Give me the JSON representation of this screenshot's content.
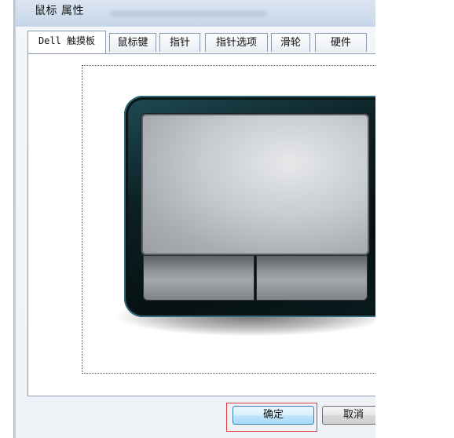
{
  "window": {
    "title": "鼠标 属性"
  },
  "tabs": [
    {
      "label": "Dell 触摸板",
      "active": true
    },
    {
      "label": "鼠标键",
      "active": false
    },
    {
      "label": "指针",
      "active": false
    },
    {
      "label": "指针选项",
      "active": false
    },
    {
      "label": "滑轮",
      "active": false
    },
    {
      "label": "硬件",
      "active": false
    }
  ],
  "illustration": {
    "icon": "touchpad-illustration"
  },
  "footer": {
    "ok_label": "确定",
    "cancel_label": "取消"
  },
  "colors": {
    "highlight": "#e0393e",
    "ok_button": "#bee6fd"
  }
}
